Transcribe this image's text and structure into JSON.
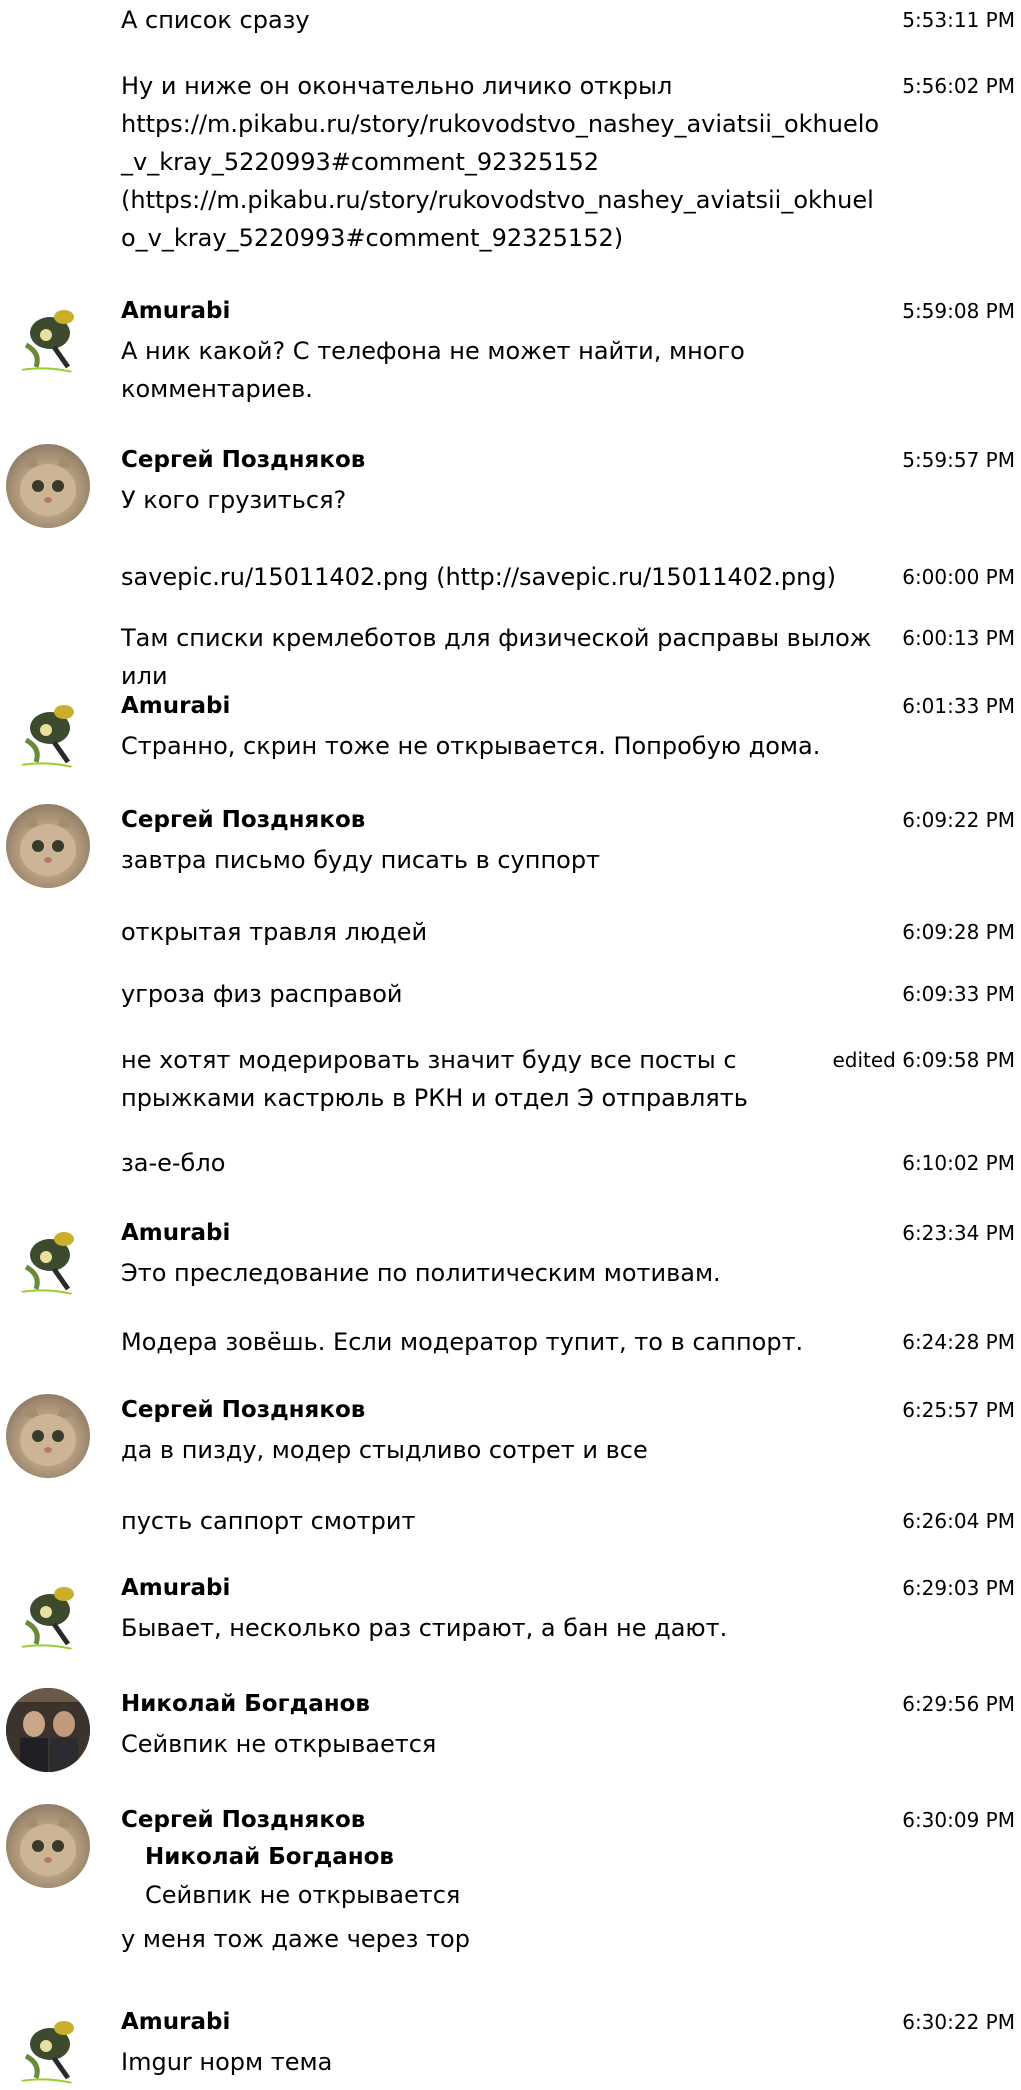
{
  "messages": [
    {
      "text": "А список сразу",
      "time": "5:53:11 PM"
    },
    {
      "text": "Ну и ниже он окончательно личико открыл\nhttps://m.pikabu.ru/story/rukovodstvo_nashey_aviatsii_okhuelo_v_kray_5220993#comment_92325152\n(https://m.pikabu.ru/story/rukovodstvo_nashey_aviatsii_okhuelo_v_kray_5220993#comment_92325152)",
      "time": "5:56:02 PM"
    },
    {
      "author": "Amurabi",
      "text": "А ник какой? С телефона не может найти, много\nкомментариев.",
      "time": "5:59:08 PM"
    },
    {
      "author": "Сергей Поздняков",
      "text": "У кого грузиться?",
      "time": "5:59:57 PM"
    },
    {
      "text": "savepic.ru/15011402.png (http://savepic.ru/15011402.png)",
      "time": "6:00:00 PM"
    },
    {
      "text": "Там списки кремлеботов для физической расправы выложили",
      "time": "6:00:13 PM"
    },
    {
      "author": "Amurabi",
      "text": "Странно, скрин тоже не открывается. Попробую дома.",
      "time": "6:01:33 PM"
    },
    {
      "author": "Сергей Поздняков",
      "text": "завтра письмо буду писать в суппорт",
      "time": "6:09:22 PM"
    },
    {
      "text": "открытая травля людей",
      "time": "6:09:28 PM"
    },
    {
      "text": "угроза физ расправой",
      "time": "6:09:33 PM"
    },
    {
      "text": "не хотят модерировать значит буду все посты с\nпрыжками кастрюль в РКН и отдел Э отправлять",
      "time": "edited 6:09:58 PM"
    },
    {
      "text": "за-е-бло",
      "time": "6:10:02 PM"
    },
    {
      "author": "Amurabi",
      "text": "Это преследование по политическим мотивам.",
      "time": "6:23:34 PM"
    },
    {
      "text": "Модера зовёшь. Если модератор тупит, то в саппорт.",
      "time": "6:24:28 PM"
    },
    {
      "author": "Сергей Поздняков",
      "text": "да в пизду, модер стыдливо сотрет и все",
      "time": "6:25:57 PM"
    },
    {
      "text": "пусть саппорт смотрит",
      "time": "6:26:04 PM"
    },
    {
      "author": "Amurabi",
      "text": "Бывает, несколько раз стирают, а бан не дают.",
      "time": "6:29:03 PM"
    },
    {
      "author": "Николай Богданов",
      "text": "Сейвпик не открывается",
      "time": "6:29:56 PM"
    },
    {
      "author": "Сергей Поздняков",
      "quote_author": "Николай Богданов",
      "quote_text": "Сейвпик не открывается",
      "text": "у меня тож даже через тор",
      "time": "6:30:09 PM"
    },
    {
      "author": "Amurabi",
      "text": "Imgur норм тема",
      "time": "6:30:22 PM"
    }
  ]
}
